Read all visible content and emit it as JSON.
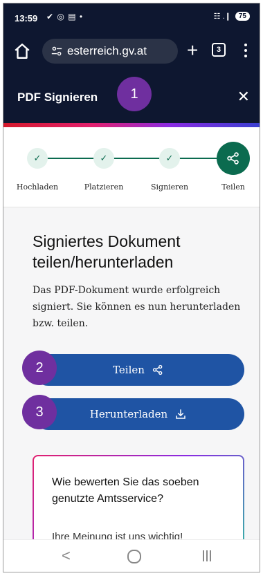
{
  "status_bar": {
    "time": "13:59",
    "left_icons": "✔ ◎ ▤ •",
    "signal": "☷ .❙",
    "battery": "75"
  },
  "browser": {
    "url": "esterreich.gv.at",
    "new_tab": "+",
    "tab_count": "3"
  },
  "header": {
    "title": "PDF Signieren",
    "close": "✕"
  },
  "markers": [
    "1",
    "2",
    "3"
  ],
  "steps": [
    {
      "label": "Hochladen",
      "state": "done",
      "icon": "✓"
    },
    {
      "label": "Platzieren",
      "state": "done",
      "icon": "✓"
    },
    {
      "label": "Signieren",
      "state": "done",
      "icon": "✓"
    },
    {
      "label": "Teilen",
      "state": "active",
      "icon": "share-icon"
    }
  ],
  "main": {
    "heading": "Signiertes Dokument teilen/herunterladen",
    "description": "Das PDF-Dokument wurde erfolgreich signiert. Sie können es nun herunterladen bzw. teilen.",
    "share_label": "Teilen",
    "download_label": "Herunterladen"
  },
  "feedback": {
    "question": "Wie bewerten Sie das soeben genutzte Amtsservice?",
    "subtext": "Ihre Meinung ist uns wichtig!"
  },
  "navbar": {
    "back": "<"
  },
  "colors": {
    "header": "#0e1730",
    "primary_button": "#1f54a4",
    "step_green": "#0b6b4f",
    "marker": "#6f2f9f"
  }
}
